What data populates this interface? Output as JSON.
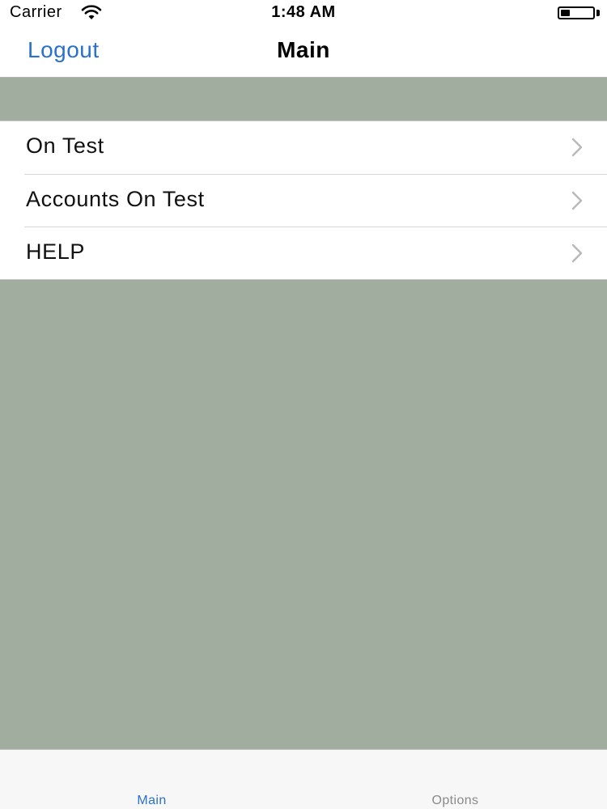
{
  "status_bar": {
    "carrier": "Carrier",
    "time": "1:48 AM",
    "battery_level": 0.3
  },
  "nav": {
    "left_button": "Logout",
    "title": "Main"
  },
  "menu": {
    "items": [
      {
        "label": "On Test",
        "icon": "chevron-right-icon"
      },
      {
        "label": "Accounts On Test",
        "icon": "chevron-right-icon"
      },
      {
        "label": "HELP",
        "icon": "chevron-right-icon"
      }
    ]
  },
  "tab_bar": {
    "tabs": [
      {
        "label": "Main",
        "selected": true
      },
      {
        "label": "Options",
        "selected": false
      }
    ]
  },
  "colors": {
    "accent": "#2a72c9",
    "background": "#a1ae9f",
    "inactive_tab": "#8a8a8a"
  }
}
